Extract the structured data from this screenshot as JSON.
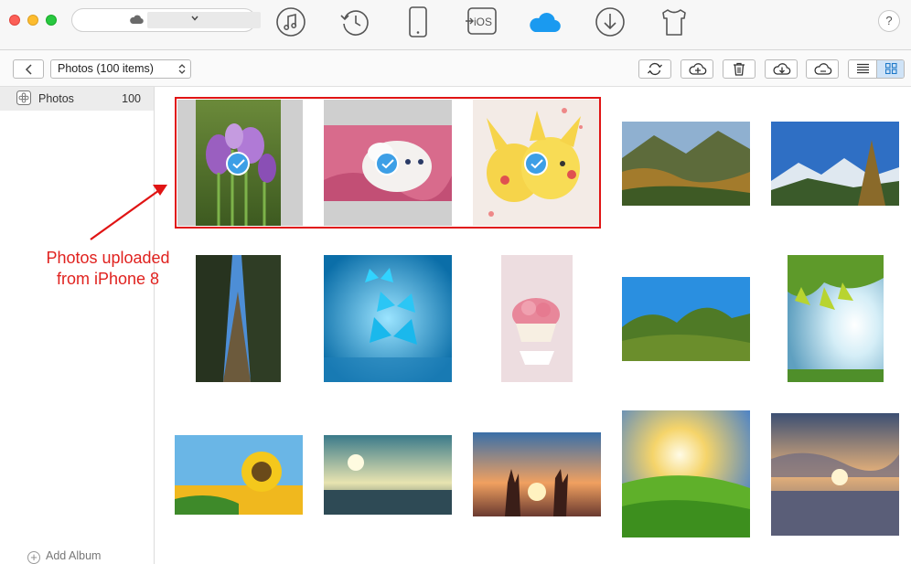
{
  "window": {
    "device_name": "",
    "help_label": "?"
  },
  "toolbar": {
    "nav_icons": [
      "music-icon",
      "history-icon",
      "iphone-icon",
      "to-ios-icon",
      "icloud-icon",
      "download-icon",
      "tshirt-icon"
    ],
    "to_ios_text": "iOS",
    "active_color": "#1a9af0"
  },
  "subbar": {
    "album_selector": "Photos (100 items)",
    "buttons": [
      "refresh-icon",
      "upload-to-cloud-icon",
      "trash-icon",
      "download-from-cloud-icon",
      "icloud-transfer-icon"
    ]
  },
  "sidebar": {
    "items": [
      {
        "label": "Photos",
        "count": "100"
      }
    ],
    "add_album": "Add Album"
  },
  "annotation": {
    "text_line1": "Photos uploaded",
    "text_line2": "from iPhone 8",
    "color": "#e01414"
  },
  "photos": [
    {
      "subject": "purple crocus flowers",
      "selected": true
    },
    {
      "subject": "white kitten",
      "selected": true
    },
    {
      "subject": "pikachu illustration",
      "selected": true
    },
    {
      "subject": "autumn mountain valley",
      "selected": false
    },
    {
      "subject": "snowy mountains",
      "selected": false
    },
    {
      "subject": "tall trees looking up",
      "selected": false
    },
    {
      "subject": "blue butterflies",
      "selected": false
    },
    {
      "subject": "cupcake with roses",
      "selected": false
    },
    {
      "subject": "green trees blue sky",
      "selected": false
    },
    {
      "subject": "sun through leaves",
      "selected": false
    },
    {
      "subject": "sunflower",
      "selected": false
    },
    {
      "subject": "sea sunset",
      "selected": false
    },
    {
      "subject": "hands at sunset",
      "selected": false
    },
    {
      "subject": "sunny grass",
      "selected": false
    },
    {
      "subject": "sunset clouds over water",
      "selected": false
    }
  ]
}
